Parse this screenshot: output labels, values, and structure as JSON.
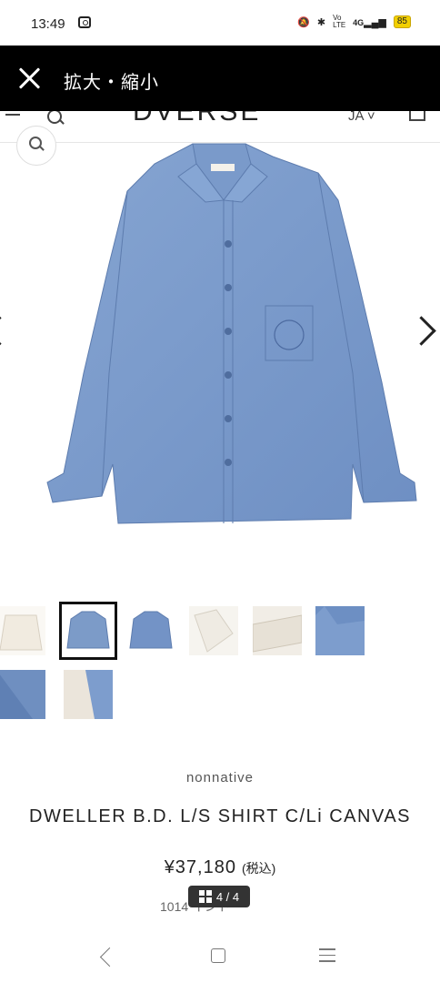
{
  "status_bar": {
    "time": "13:49",
    "indicators": [
      "mute-bell-icon",
      "bluetooth-icon",
      "volte-icon",
      "4g-signal-icon"
    ],
    "volte": "Vo\nLTE",
    "network": "4G",
    "battery": "85"
  },
  "overlay": {
    "title": "拡大・縮小",
    "close_icon": "close-icon"
  },
  "page_header": {
    "logo": "DVERSE",
    "language": "JA"
  },
  "product": {
    "brand": "nonnative",
    "title": "DWELLER B.D. L/S SHIRT C/Li CANVAS",
    "price": "¥37,180",
    "tax_note": "(税込)",
    "sub_text": "1014  イント",
    "image_counter": "4 / 4"
  },
  "thumbnails": [
    {
      "name": "thumb-cream-shirt",
      "color": "#f1ebe0"
    },
    {
      "name": "thumb-blue-shirt-selected",
      "color": "#7c9bc8"
    },
    {
      "name": "thumb-blue-shirt-back",
      "color": "#7393c6"
    },
    {
      "name": "thumb-white-collar",
      "color": "#efebe3"
    },
    {
      "name": "thumb-cream-detail",
      "color": "#e7e1d6"
    },
    {
      "name": "thumb-blue-detail",
      "color": "#6d8fc3"
    },
    {
      "name": "thumb-blue-fabric",
      "color": "#6f8fc0"
    },
    {
      "name": "thumb-mixed-fabric",
      "color": "#b5c4d9"
    }
  ],
  "colors": {
    "overlay_bg": "#000000",
    "shirt_blue": "#7d9dcd",
    "battery": "#f2d000"
  }
}
